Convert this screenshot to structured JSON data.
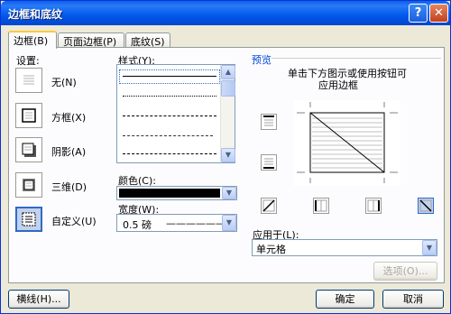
{
  "window": {
    "title": "边框和底纹",
    "help": "?",
    "close": "✕"
  },
  "tabs": [
    {
      "label": "边框(B)",
      "active": true
    },
    {
      "label": "页面边框(P)",
      "active": false
    },
    {
      "label": "底纹(S)",
      "active": false
    }
  ],
  "settings": {
    "heading": "设置:",
    "items": [
      {
        "label": "无(N)",
        "icon": "none-border-icon"
      },
      {
        "label": "方框(X)",
        "icon": "box-border-icon"
      },
      {
        "label": "阴影(A)",
        "icon": "shadow-border-icon"
      },
      {
        "label": "三维(D)",
        "icon": "3d-border-icon"
      },
      {
        "label": "自定义(U)",
        "icon": "custom-border-icon",
        "selected": true
      }
    ]
  },
  "style": {
    "heading": "样式(Y):",
    "lines": [
      "solid",
      "dotted",
      "dashed-small",
      "dashed",
      "dash-dot"
    ]
  },
  "color": {
    "heading": "颜色(C):",
    "value": "#000000"
  },
  "width": {
    "heading": "宽度(W):",
    "value": "0.5 磅",
    "line": "——————"
  },
  "preview": {
    "heading": "预览",
    "instructions_line1": "单击下方图示或使用按钮可",
    "instructions_line2": "应用边框"
  },
  "apply_to": {
    "heading": "应用于(L):",
    "value": "单元格"
  },
  "buttons": {
    "options": "选项(O)...",
    "toolbar": "横线(H)...",
    "ok": "确定",
    "cancel": "取消"
  }
}
